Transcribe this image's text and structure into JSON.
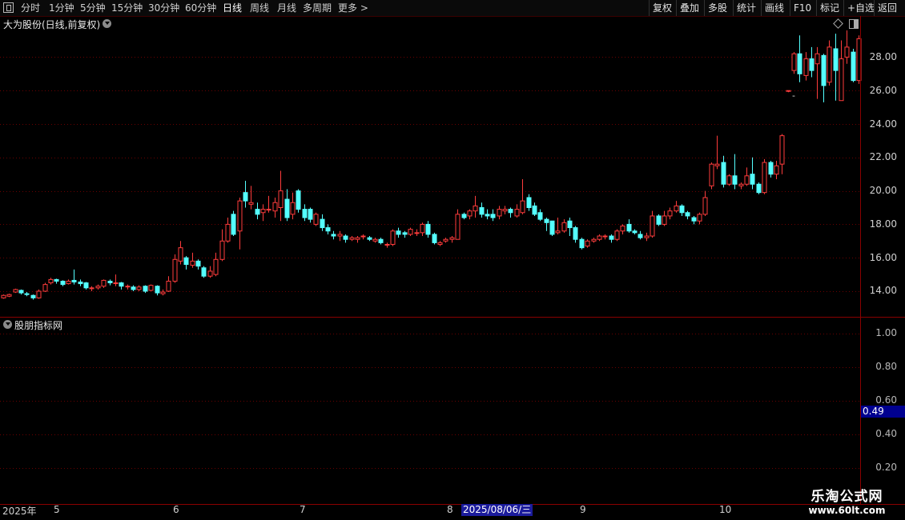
{
  "toolbar": {
    "periods": [
      "分时",
      "1分钟",
      "5分钟",
      "15分钟",
      "30分钟",
      "60分钟",
      "日线",
      "周线",
      "月线",
      "多周期",
      "更多 >"
    ],
    "active_period": "日线",
    "right_buttons": [
      "复权",
      "叠加",
      "多股",
      "统计",
      "画线",
      "F10",
      "标记",
      "+自选",
      "返回"
    ]
  },
  "chart": {
    "title": "大为股份(日线,前复权)",
    "price_axis": [
      "28.00",
      "26.00",
      "24.00",
      "22.00",
      "20.00",
      "18.00",
      "16.00",
      "14.00"
    ],
    "low_marker": "-",
    "up_color": "#ff3c3c",
    "down_color": "#54ffff"
  },
  "indicator": {
    "title": "股朋指标网",
    "axis": [
      "1.00",
      "0.80",
      "0.60",
      "0.40",
      "0.20"
    ],
    "current_value": "0.49"
  },
  "date_axis": {
    "labels": [
      "2025年",
      "5",
      "6",
      "7",
      "8",
      "9",
      "10"
    ],
    "highlight": "2025/08/06/三"
  },
  "watermark": {
    "line1": "乐淘公式网",
    "line2": "www.60lt.com"
  },
  "candles": [
    [
      13.6,
      13.75,
      13.55,
      13.8
    ],
    [
      13.7,
      13.8,
      13.65,
      13.85
    ],
    [
      13.95,
      14.1,
      13.9,
      14.15
    ],
    [
      14.05,
      13.9,
      13.8,
      14.1
    ],
    [
      13.85,
      13.8,
      13.7,
      13.95
    ],
    [
      13.75,
      13.6,
      13.5,
      13.8
    ],
    [
      13.6,
      14.0,
      13.55,
      14.1
    ],
    [
      14.0,
      14.4,
      13.95,
      14.5
    ],
    [
      14.5,
      14.7,
      14.4,
      14.8
    ],
    [
      14.7,
      14.6,
      14.45,
      14.75
    ],
    [
      14.6,
      14.4,
      14.3,
      14.65
    ],
    [
      14.45,
      14.6,
      14.4,
      14.7
    ],
    [
      14.65,
      14.55,
      14.4,
      15.3
    ],
    [
      14.55,
      14.45,
      14.3,
      14.7
    ],
    [
      14.5,
      14.2,
      14.1,
      14.55
    ],
    [
      14.15,
      14.2,
      14.0,
      14.3
    ],
    [
      14.2,
      14.3,
      14.1,
      14.4
    ],
    [
      14.3,
      14.65,
      14.2,
      14.7
    ],
    [
      14.6,
      14.5,
      14.35,
      14.7
    ],
    [
      14.5,
      14.5,
      14.3,
      15.0
    ],
    [
      14.5,
      14.3,
      14.1,
      14.55
    ],
    [
      14.3,
      14.3,
      14.1,
      14.4
    ],
    [
      14.25,
      14.1,
      14.0,
      14.35
    ],
    [
      14.1,
      14.25,
      14.0,
      14.35
    ],
    [
      14.3,
      14.0,
      13.9,
      14.35
    ],
    [
      14.05,
      14.35,
      14.0,
      14.4
    ],
    [
      14.3,
      13.9,
      13.75,
      14.35
    ],
    [
      13.85,
      13.95,
      13.75,
      14.1
    ],
    [
      14.0,
      14.6,
      13.95,
      14.9
    ],
    [
      14.6,
      15.9,
      14.5,
      16.2
    ],
    [
      15.8,
      16.6,
      15.6,
      17.0
    ],
    [
      16.0,
      15.6,
      15.3,
      16.1
    ],
    [
      15.55,
      15.8,
      15.4,
      16.3
    ],
    [
      15.8,
      15.5,
      15.3,
      15.9
    ],
    [
      15.4,
      14.9,
      14.8,
      15.5
    ],
    [
      14.9,
      15.2,
      14.8,
      15.5
    ],
    [
      15.0,
      15.9,
      14.9,
      16.3
    ],
    [
      15.9,
      17.0,
      15.8,
      17.7
    ],
    [
      17.0,
      18.0,
      16.9,
      18.4
    ],
    [
      18.6,
      17.4,
      17.3,
      18.8
    ],
    [
      17.6,
      19.4,
      16.5,
      19.6
    ],
    [
      19.9,
      19.4,
      19.0,
      20.6
    ],
    [
      19.2,
      19.3,
      18.9,
      20.3
    ],
    [
      18.9,
      18.6,
      18.3,
      19.3
    ],
    [
      18.7,
      18.9,
      18.2,
      19.2
    ],
    [
      18.9,
      18.9,
      18.7,
      19.7
    ],
    [
      18.8,
      19.3,
      18.4,
      19.6
    ],
    [
      19.0,
      20.0,
      18.2,
      21.2
    ],
    [
      19.5,
      18.4,
      18.2,
      20.1
    ],
    [
      18.6,
      19.3,
      18.3,
      19.9
    ],
    [
      20.0,
      18.9,
      18.7,
      20.1
    ],
    [
      18.9,
      18.4,
      18.2,
      19.2
    ],
    [
      18.9,
      18.3,
      18.1,
      19.0
    ],
    [
      18.0,
      18.6,
      17.9,
      18.7
    ],
    [
      18.3,
      17.8,
      17.6,
      18.6
    ],
    [
      17.8,
      17.6,
      17.4,
      18.0
    ],
    [
      17.4,
      17.3,
      17.1,
      17.6
    ],
    [
      17.3,
      17.4,
      17.0,
      17.6
    ],
    [
      17.3,
      17.1,
      16.9,
      17.4
    ],
    [
      17.1,
      17.2,
      17.0,
      17.3
    ],
    [
      17.1,
      17.2,
      16.9,
      17.3
    ],
    [
      17.3,
      17.3,
      17.1,
      17.4
    ],
    [
      17.2,
      17.1,
      17.0,
      17.3
    ],
    [
      17.0,
      17.1,
      16.9,
      17.2
    ],
    [
      17.1,
      16.9,
      16.8,
      17.2
    ],
    [
      16.8,
      16.8,
      16.6,
      16.9
    ],
    [
      16.8,
      17.6,
      16.7,
      17.7
    ],
    [
      17.6,
      17.4,
      17.2,
      17.8
    ],
    [
      17.5,
      17.4,
      17.2,
      17.6
    ],
    [
      17.4,
      17.7,
      17.3,
      17.8
    ],
    [
      17.5,
      17.5,
      17.3,
      17.7
    ],
    [
      17.5,
      18.0,
      17.3,
      18.1
    ],
    [
      18.0,
      17.4,
      17.2,
      18.2
    ],
    [
      17.4,
      16.9,
      16.8,
      17.5
    ],
    [
      16.8,
      16.9,
      16.7,
      17.0
    ],
    [
      17.0,
      17.1,
      16.9,
      17.2
    ],
    [
      17.1,
      17.2,
      16.9,
      17.3
    ],
    [
      17.1,
      18.6,
      17.1,
      18.9
    ],
    [
      18.6,
      18.4,
      18.3,
      18.7
    ],
    [
      18.5,
      18.8,
      18.3,
      18.9
    ],
    [
      18.8,
      19.1,
      18.4,
      19.7
    ],
    [
      19.0,
      18.6,
      18.4,
      19.3
    ],
    [
      18.6,
      18.5,
      18.3,
      18.9
    ],
    [
      18.6,
      18.4,
      18.2,
      18.9
    ],
    [
      18.5,
      18.9,
      18.3,
      19.1
    ],
    [
      18.8,
      18.9,
      18.6,
      19.1
    ],
    [
      18.9,
      18.7,
      18.4,
      19.0
    ],
    [
      18.5,
      18.9,
      18.4,
      19.2
    ],
    [
      18.7,
      19.4,
      18.6,
      20.7
    ],
    [
      19.6,
      19.0,
      18.8,
      19.8
    ],
    [
      19.1,
      18.6,
      18.5,
      19.3
    ],
    [
      18.7,
      18.3,
      18.2,
      18.9
    ],
    [
      18.3,
      18.1,
      17.6,
      18.4
    ],
    [
      18.2,
      17.4,
      17.3,
      18.2
    ],
    [
      17.5,
      17.6,
      17.4,
      18.4
    ],
    [
      17.6,
      18.1,
      17.5,
      18.3
    ],
    [
      18.2,
      17.8,
      17.3,
      18.4
    ],
    [
      17.8,
      17.1,
      16.9,
      17.9
    ],
    [
      17.1,
      16.6,
      16.5,
      17.2
    ],
    [
      16.7,
      17.0,
      16.6,
      17.1
    ],
    [
      17.0,
      17.1,
      16.9,
      17.2
    ],
    [
      17.1,
      17.3,
      17.0,
      17.4
    ],
    [
      17.3,
      17.3,
      17.1,
      17.4
    ],
    [
      17.3,
      17.1,
      16.9,
      17.4
    ],
    [
      17.1,
      17.6,
      17.0,
      17.7
    ],
    [
      17.6,
      17.9,
      17.4,
      18.0
    ],
    [
      18.0,
      17.6,
      17.5,
      18.3
    ],
    [
      17.6,
      17.5,
      17.4,
      17.7
    ],
    [
      17.4,
      17.2,
      17.1,
      17.6
    ],
    [
      17.2,
      17.3,
      17.0,
      17.5
    ],
    [
      17.3,
      18.5,
      17.2,
      18.8
    ],
    [
      18.5,
      18.0,
      17.9,
      18.6
    ],
    [
      18.0,
      18.5,
      17.9,
      18.8
    ],
    [
      18.5,
      18.8,
      18.3,
      19.0
    ],
    [
      18.8,
      19.1,
      18.7,
      19.4
    ],
    [
      19.1,
      18.7,
      18.5,
      19.2
    ],
    [
      18.7,
      18.5,
      18.3,
      18.8
    ],
    [
      18.4,
      18.2,
      18.0,
      18.5
    ],
    [
      18.2,
      18.6,
      18.0,
      18.7
    ],
    [
      18.6,
      19.6,
      18.5,
      20.0
    ],
    [
      20.3,
      21.6,
      20.1,
      21.7
    ],
    [
      21.5,
      21.6,
      21.3,
      23.3
    ],
    [
      21.7,
      20.4,
      20.2,
      22.1
    ],
    [
      20.4,
      20.9,
      20.3,
      21.0
    ],
    [
      20.9,
      20.4,
      20.1,
      22.2
    ],
    [
      20.3,
      20.4,
      20.1,
      20.5
    ],
    [
      20.4,
      20.9,
      20.3,
      21.4
    ],
    [
      21.0,
      20.4,
      20.1,
      22.0
    ],
    [
      20.4,
      19.9,
      19.8,
      20.5
    ],
    [
      19.9,
      21.7,
      19.8,
      21.9
    ],
    [
      21.7,
      21.0,
      20.8,
      21.8
    ],
    [
      21.0,
      21.5,
      20.7,
      21.8
    ],
    [
      21.6,
      23.3,
      21.0,
      23.4
    ],
    [
      26.0,
      26.0,
      25.9,
      26.0
    ],
    [
      27.2,
      28.2,
      27.0,
      28.3
    ],
    [
      28.2,
      27.0,
      26.5,
      29.3
    ],
    [
      26.9,
      27.9,
      26.6,
      28.3
    ],
    [
      27.9,
      27.2,
      26.8,
      28.6
    ],
    [
      27.6,
      28.2,
      25.5,
      28.6
    ],
    [
      28.1,
      26.3,
      25.3,
      28.2
    ],
    [
      26.5,
      28.6,
      26.3,
      29.0
    ],
    [
      28.5,
      27.2,
      25.4,
      29.4
    ],
    [
      25.4,
      27.9,
      25.4,
      29.0
    ],
    [
      28.0,
      28.6,
      27.6,
      29.6
    ],
    [
      28.3,
      26.6,
      26.5,
      28.5
    ],
    [
      26.6,
      29.1,
      26.4,
      29.3
    ]
  ]
}
